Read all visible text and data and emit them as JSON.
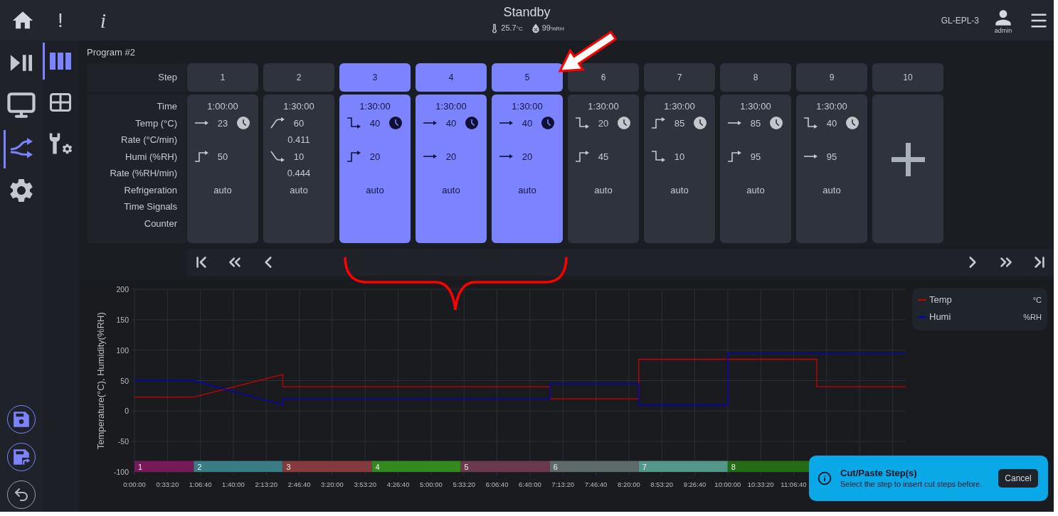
{
  "top_bar": {
    "alert_button": "!",
    "info_button": "i",
    "status": "Standby",
    "temperature": "25.7",
    "temperature_unit": "°C",
    "humidity": "99",
    "humidity_unit": "%RH",
    "device": "GL-EPL-3",
    "user": "admin"
  },
  "main_nav": [
    {
      "selected": false
    },
    {
      "selected": false
    },
    {
      "selected": true
    },
    {
      "selected": false
    }
  ],
  "sub_nav": [
    {
      "selected": true
    },
    {
      "selected": false
    },
    {
      "selected": false
    }
  ],
  "program": {
    "title": "Program #2",
    "step_label": "Step",
    "row_labels": [
      "Time",
      "Temp (°C)",
      "Rate (°C/min)",
      "Humi (%RH)",
      "Rate (%RH/min)",
      "Refrigeration",
      "Time Signals",
      "Counter"
    ]
  },
  "steps": [
    {
      "kind": "step",
      "number": "1",
      "selected": false,
      "time": "1:00:00",
      "temp": {
        "kind": "constant",
        "value": "23"
      },
      "clock": true,
      "humi": {
        "kind": "jump_up",
        "value": "50"
      },
      "refrigeration": "auto"
    },
    {
      "kind": "step",
      "number": "2",
      "selected": false,
      "time": "1:30:00",
      "temp": {
        "kind": "ramp_up",
        "value": "60"
      },
      "clock": false,
      "temp_rate": "0.411",
      "humi": {
        "kind": "ramp_down",
        "value": "10"
      },
      "humi_rate": "0.444",
      "refrigeration": "auto"
    },
    {
      "kind": "step",
      "number": "3",
      "selected": true,
      "time": "1:30:00",
      "temp": {
        "kind": "jump_down",
        "value": "40"
      },
      "clock": true,
      "humi": {
        "kind": "jump_up",
        "value": "20"
      },
      "refrigeration": "auto"
    },
    {
      "kind": "step",
      "number": "4",
      "selected": true,
      "time": "1:30:00",
      "temp": {
        "kind": "constant",
        "value": "40"
      },
      "clock": true,
      "humi": {
        "kind": "constant",
        "value": "20"
      },
      "refrigeration": "auto"
    },
    {
      "kind": "step",
      "number": "5",
      "selected": true,
      "time": "1:30:00",
      "temp": {
        "kind": "constant",
        "value": "40"
      },
      "clock": true,
      "humi": {
        "kind": "constant",
        "value": "20"
      },
      "refrigeration": "auto"
    },
    {
      "kind": "step",
      "number": "6",
      "selected": false,
      "time": "1:30:00",
      "temp": {
        "kind": "jump_down",
        "value": "20"
      },
      "clock": true,
      "humi": {
        "kind": "jump_up",
        "value": "45"
      },
      "refrigeration": "auto"
    },
    {
      "kind": "step",
      "number": "7",
      "selected": false,
      "time": "1:30:00",
      "temp": {
        "kind": "jump_up",
        "value": "85"
      },
      "clock": true,
      "humi": {
        "kind": "jump_down",
        "value": "10"
      },
      "refrigeration": "auto"
    },
    {
      "kind": "step",
      "number": "8",
      "selected": false,
      "time": "1:30:00",
      "temp": {
        "kind": "constant",
        "value": "85"
      },
      "clock": true,
      "humi": {
        "kind": "jump_up",
        "value": "95"
      },
      "refrigeration": "auto"
    },
    {
      "kind": "step",
      "number": "9",
      "selected": false,
      "time": "1:30:00",
      "temp": {
        "kind": "jump_down",
        "value": "40"
      },
      "clock": true,
      "humi": {
        "kind": "constant",
        "value": "95"
      },
      "refrigeration": "auto"
    },
    {
      "kind": "add",
      "number": "10",
      "selected": false
    }
  ],
  "chart": {
    "legend_units": [
      "°C",
      "%RH"
    ],
    "step_bar": [
      {
        "label": "1",
        "color": "#751a57"
      },
      {
        "label": "2",
        "color": "#3a7c84"
      },
      {
        "label": "3",
        "color": "#843a3e"
      },
      {
        "label": "4",
        "color": "#328a1e"
      },
      {
        "label": "5",
        "color": "#6a3a4c"
      },
      {
        "label": "6",
        "color": "#5e6a68"
      },
      {
        "label": "7",
        "color": "#549688"
      },
      {
        "label": "8",
        "color": "#246c14"
      }
    ],
    "chart_data": {
      "type": "line",
      "ylabel": "Temperature(°C), Humidity(%RH)",
      "x": [
        0,
        3600,
        9000,
        9000,
        25200,
        25200,
        30600,
        30600,
        36000,
        36000,
        41400,
        41400,
        46800
      ],
      "series": [
        {
          "name": "Temp",
          "color": "#cc0000",
          "values": [
            23,
            23,
            60,
            40,
            40,
            20,
            20,
            85,
            85,
            85,
            85,
            40,
            40
          ]
        },
        {
          "name": "Humi",
          "color": "#0000cc",
          "values": [
            50,
            50,
            10,
            20,
            20,
            45,
            45,
            10,
            10,
            95,
            95,
            95,
            95
          ]
        }
      ],
      "xlim": [
        0,
        46800
      ],
      "ylim": [
        -100,
        200
      ],
      "xticks": [
        {
          "value": 0,
          "label": "0:00:00"
        },
        {
          "value": 2000,
          "label": "0:33:20"
        },
        {
          "value": 4000,
          "label": "1:06:40"
        },
        {
          "value": 6000,
          "label": "1:40:00"
        },
        {
          "value": 8000,
          "label": "2:13:20"
        },
        {
          "value": 10000,
          "label": "2:46:40"
        },
        {
          "value": 12000,
          "label": "3:20:00"
        },
        {
          "value": 14000,
          "label": "3:53:20"
        },
        {
          "value": 16000,
          "label": "4:26:40"
        },
        {
          "value": 18000,
          "label": "5:00:00"
        },
        {
          "value": 20000,
          "label": "5:33:20"
        },
        {
          "value": 22000,
          "label": "6:06:40"
        },
        {
          "value": 24000,
          "label": "6:40:00"
        },
        {
          "value": 26000,
          "label": "7:13:20"
        },
        {
          "value": 28000,
          "label": "7:46:40"
        },
        {
          "value": 30000,
          "label": "8:20:00"
        },
        {
          "value": 32000,
          "label": "8:53:20"
        },
        {
          "value": 34000,
          "label": "9:26:40"
        },
        {
          "value": 36000,
          "label": "10:00:00"
        },
        {
          "value": 38000,
          "label": "10:33:20"
        },
        {
          "value": 40000,
          "label": "11:06:40"
        }
      ],
      "yticks": [
        -100,
        -50,
        0,
        50,
        100,
        150,
        200
      ],
      "grid": true,
      "legend": "right"
    }
  },
  "toast": {
    "title": "Cut/Paste Step(s)",
    "message": "Select the step to insert cut steps before.",
    "button": "Cancel"
  },
  "callouts": [
    {
      "kind": "arrow"
    },
    {
      "kind": "brace"
    }
  ]
}
